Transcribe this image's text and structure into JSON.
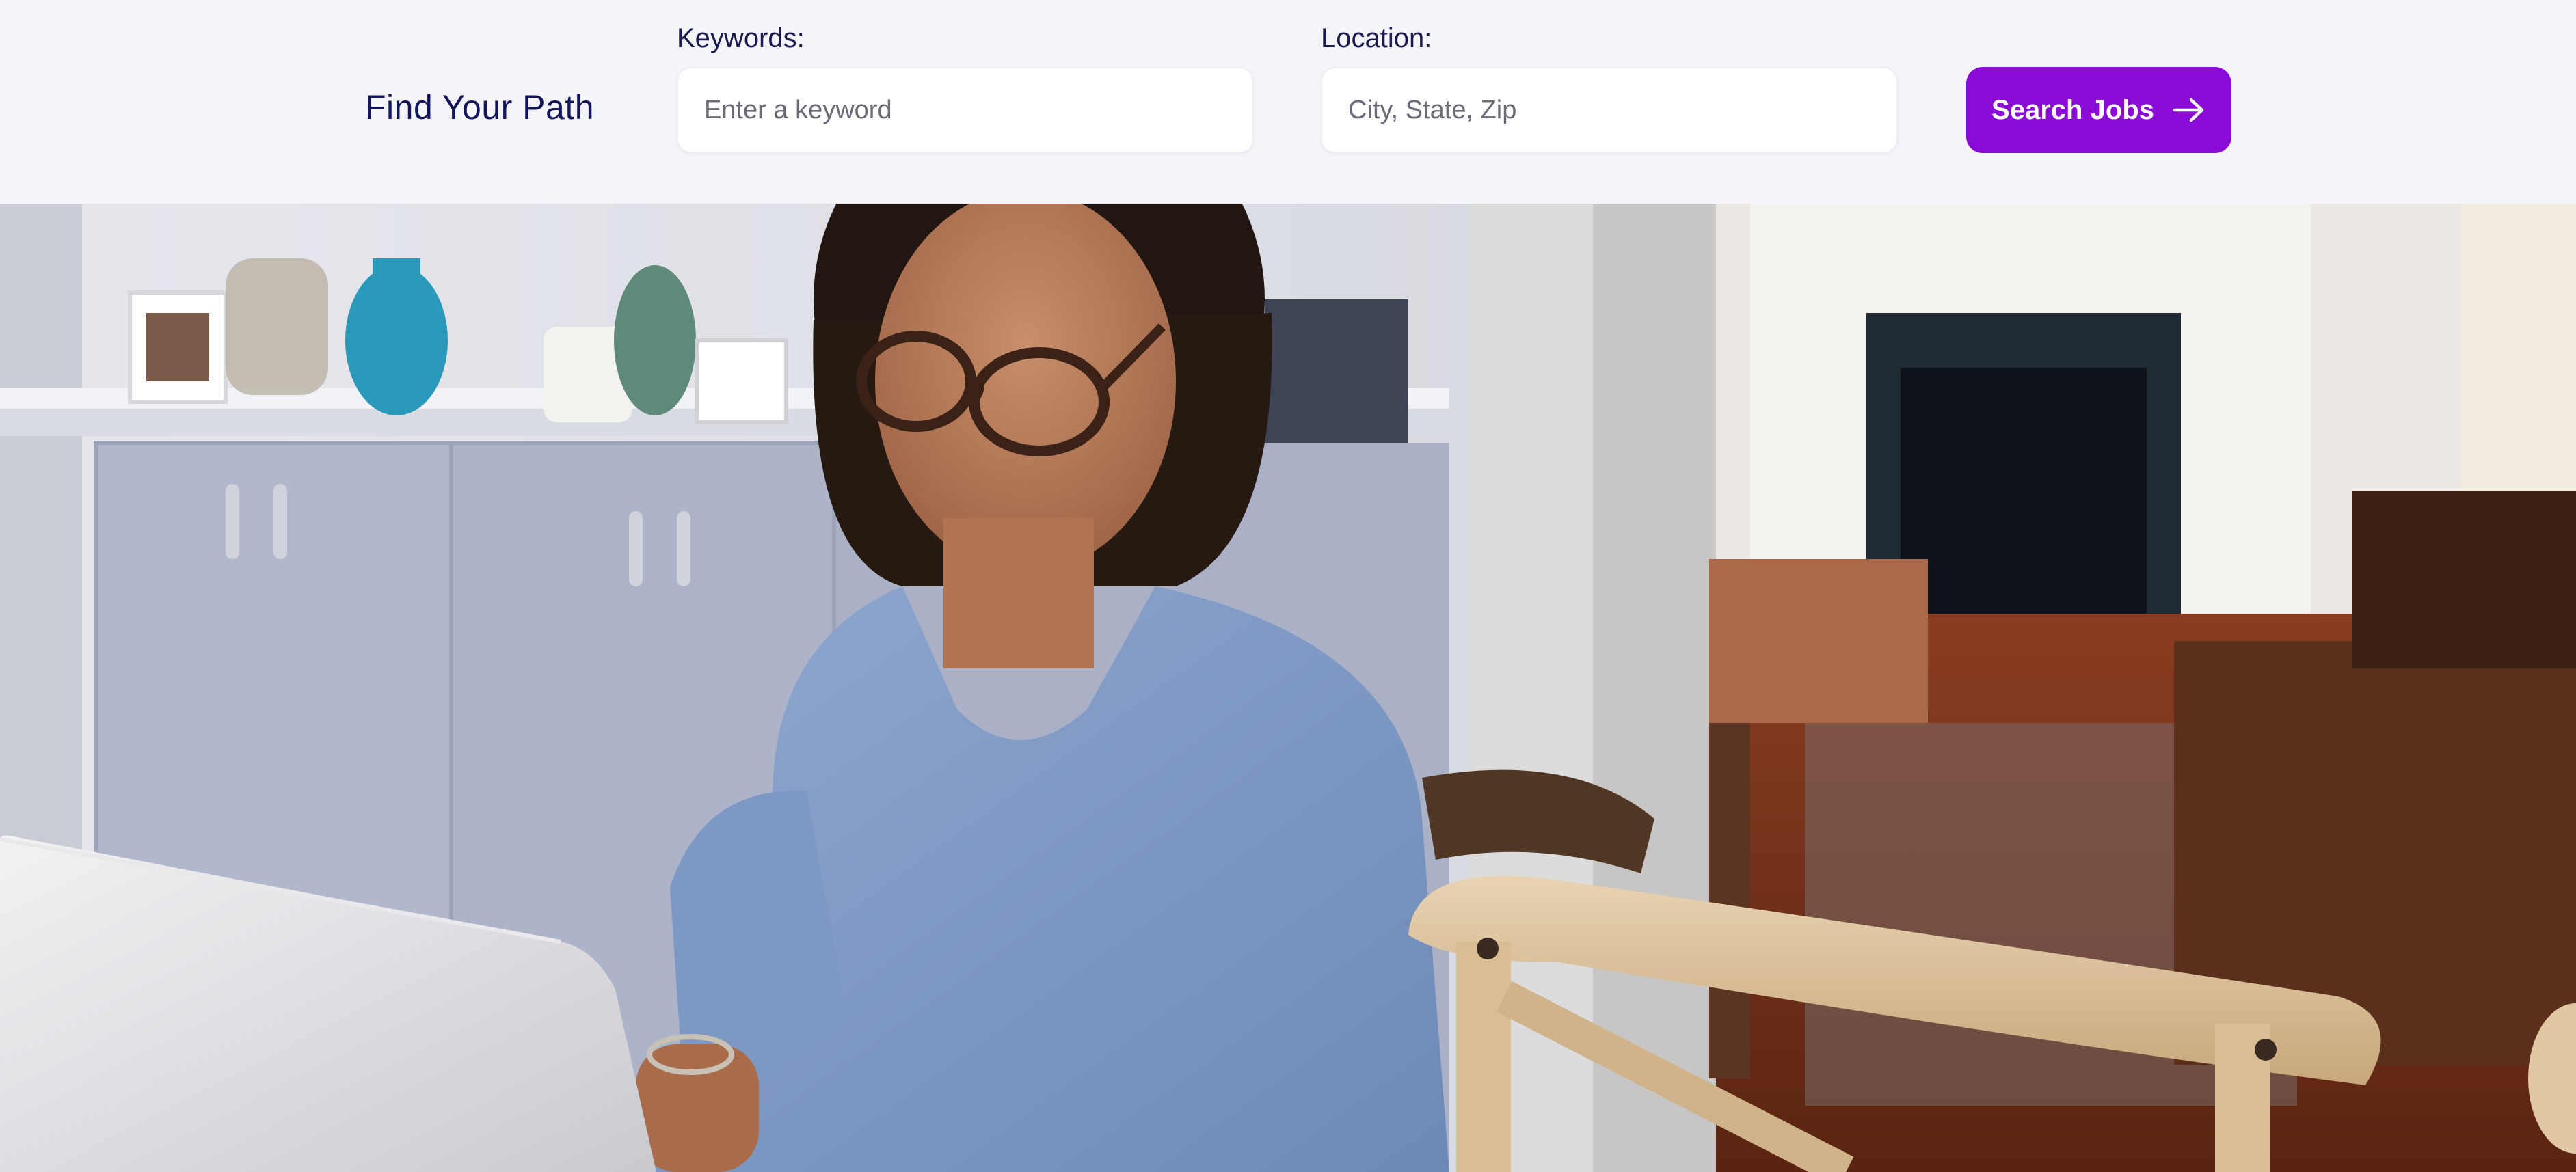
{
  "search": {
    "title": "Find Your Path",
    "keywords_label": "Keywords:",
    "keywords_placeholder": "Enter a keyword",
    "keywords_value": "",
    "location_label": "Location:",
    "location_placeholder": "City, State, Zip",
    "location_value": "",
    "button_label": "Search Jobs",
    "button_icon": "arrow-right-icon"
  },
  "colors": {
    "brand_purple": "#8a0ad6",
    "heading_navy": "#14145a",
    "background": "#f4f5f9"
  },
  "hero": {
    "image": "woman-working-on-laptop-at-home-photo"
  }
}
